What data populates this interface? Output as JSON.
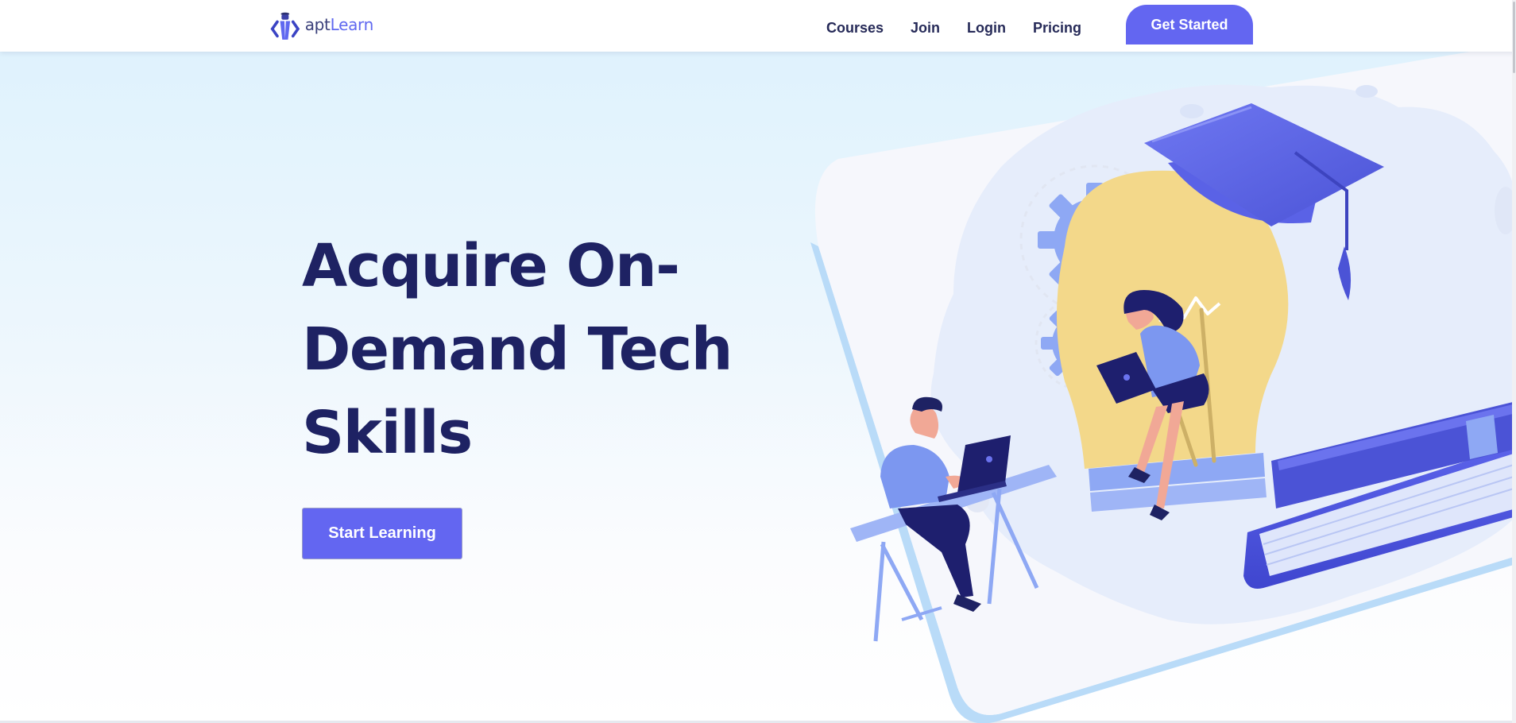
{
  "nav": {
    "logo_apt": "apt",
    "logo_learn": "Learn",
    "links": [
      {
        "label": "Courses"
      },
      {
        "label": "Join"
      },
      {
        "label": "Login"
      },
      {
        "label": "Pricing"
      }
    ],
    "cta_label": "Get Started"
  },
  "hero": {
    "title_lines": [
      "Acquire On-",
      "Demand Tech",
      "Skills"
    ],
    "button_label": "Start Learning"
  },
  "colors": {
    "accent": "#6366f1",
    "heading": "#1e2263",
    "nav_text": "#262a58",
    "bulb": "#f3d88a",
    "illustration_blue": "#7c86ee"
  },
  "illustration": {
    "icons": [
      "light-bulb-icon",
      "graduation-cap-icon",
      "gear-icon",
      "laptop-icon",
      "book-icon",
      "student-figure-icon"
    ]
  }
}
